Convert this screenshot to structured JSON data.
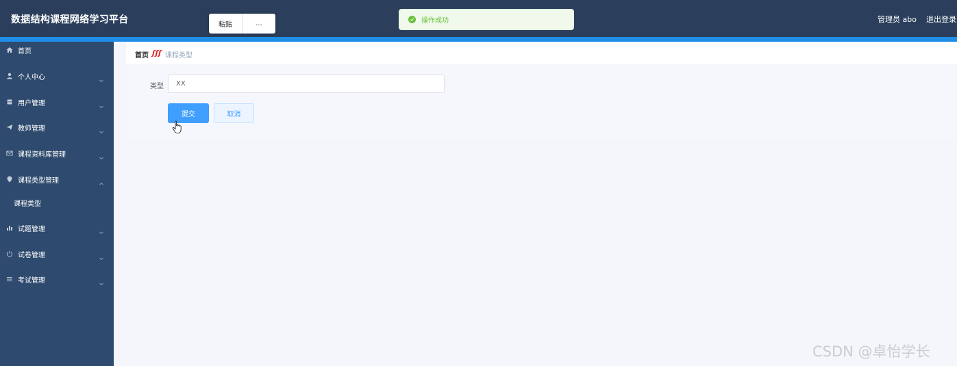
{
  "header": {
    "app_title": "数据结构课程网络学习平台",
    "user_label": "管理员 abo",
    "logout_label": "退出登录"
  },
  "context_menu": {
    "paste_label": "粘贴",
    "more_label": "..."
  },
  "toast": {
    "message": "操作成功",
    "icon": "check-circle-icon",
    "color": "#67c23a"
  },
  "sidebar": {
    "background": "#2e4a6e",
    "items": [
      {
        "label": "首页",
        "icon": "home-icon"
      },
      {
        "label": "个人中心",
        "icon": "user-icon"
      },
      {
        "label": "用户管理",
        "icon": "users-icon"
      },
      {
        "label": "教师管理",
        "icon": "send-icon"
      },
      {
        "label": "课程资料库管理",
        "icon": "mail-icon"
      },
      {
        "label": "课程类型管理",
        "icon": "location-icon",
        "expanded": true,
        "children": [
          "课程类型"
        ]
      },
      {
        "label": "试题管理",
        "icon": "bar-chart-icon"
      },
      {
        "label": "试卷管理",
        "icon": "power-icon"
      },
      {
        "label": "考试管理",
        "icon": "menu-icon"
      }
    ]
  },
  "breadcrumb": {
    "home": "首页",
    "current": "课程类型"
  },
  "form": {
    "type_label": "类型",
    "type_value": "XX",
    "submit_label": "提交",
    "cancel_label": "取消"
  },
  "accent_color": "#409eff",
  "watermark": "CSDN @卓怡学长"
}
